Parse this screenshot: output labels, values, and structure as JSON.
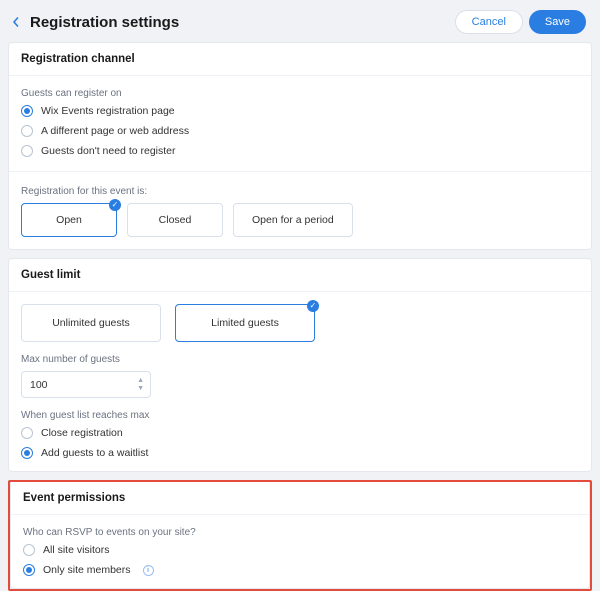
{
  "header": {
    "title": "Registration settings",
    "cancel": "Cancel",
    "save": "Save"
  },
  "channel": {
    "title": "Registration channel",
    "where_label": "Guests can register on",
    "options": [
      "Wix Events registration page",
      "A different page or web address",
      "Guests don't need to register"
    ],
    "status_label": "Registration for this event is:",
    "statuses": [
      "Open",
      "Closed",
      "Open for a period"
    ]
  },
  "guest_limit": {
    "title": "Guest limit",
    "modes": [
      "Unlimited guests",
      "Limited guests"
    ],
    "max_label": "Max number of guests",
    "max_value": "100",
    "max_action_label": "When guest list reaches max",
    "max_actions": [
      "Close registration",
      "Add guests to a waitlist"
    ]
  },
  "permissions": {
    "title": "Event permissions",
    "question": "Who can RSVP to events on your site?",
    "options": [
      "All site visitors",
      "Only site members"
    ]
  }
}
